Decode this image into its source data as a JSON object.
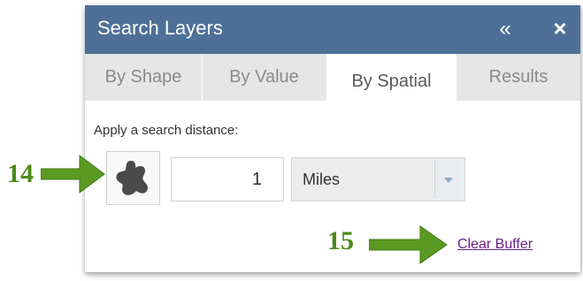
{
  "panel": {
    "title": "Search Layers",
    "collapse_icon": "«",
    "close_icon": "×",
    "tabs": [
      {
        "label": "By Shape",
        "active": false
      },
      {
        "label": "By Value",
        "active": false
      },
      {
        "label": "By Spatial",
        "active": true
      },
      {
        "label": "Results",
        "active": false
      }
    ]
  },
  "spatial": {
    "apply_label": "Apply a search distance:",
    "shape_icon": "buffer-shape-icon",
    "distance_value": "1",
    "units_selected": "Miles",
    "clear_buffer_label": "Clear Buffer"
  },
  "callouts": [
    {
      "number": "14",
      "icon": "green-arrow-right"
    },
    {
      "number": "15",
      "icon": "green-arrow-right"
    }
  ],
  "colors": {
    "header": "#4e7098",
    "tab_bar": "#e6e6e6",
    "link": "#6a1f86",
    "callout": "#4c8a1b"
  }
}
